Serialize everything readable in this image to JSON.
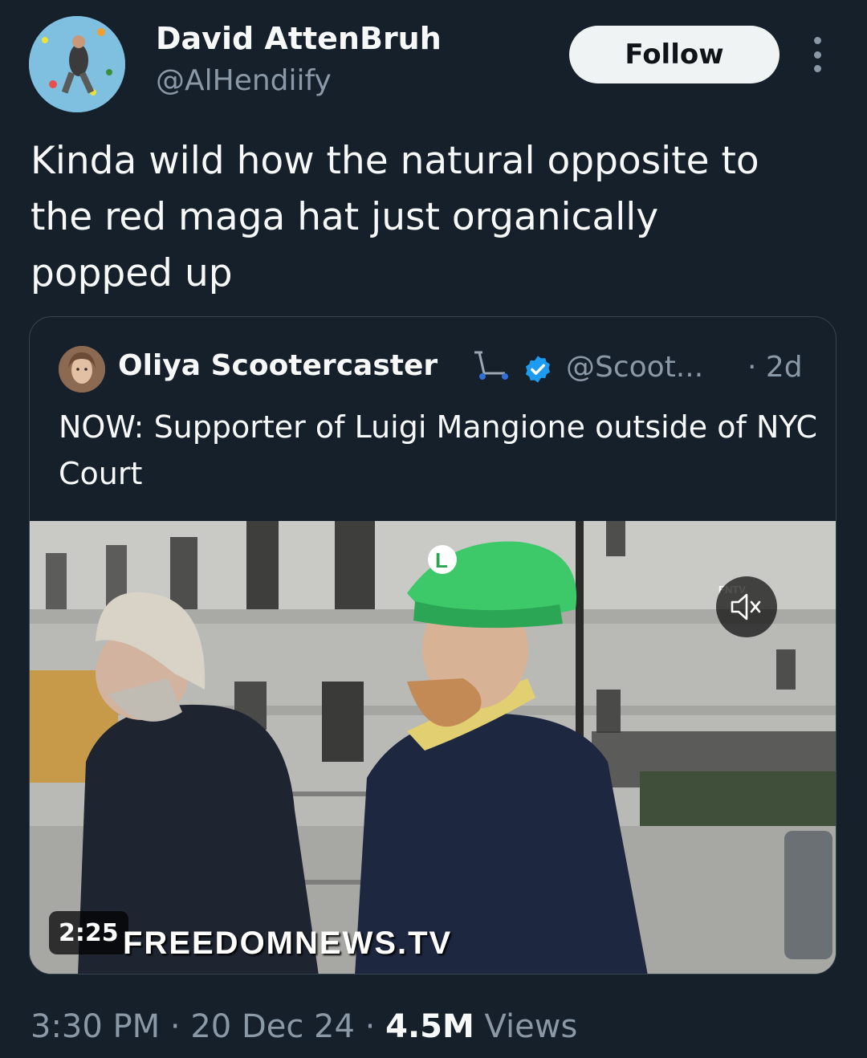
{
  "author": {
    "display_name": "David AttenBruh",
    "handle": "@AlHendiify"
  },
  "follow_label": "Follow",
  "tweet_text": "Kinda wild how the natural opposite to the red maga hat just organically popped up",
  "quoted": {
    "display_name": "Oliya Scootercaster",
    "handle": "@Scoot...",
    "time": "· 2d",
    "text": "NOW: Supporter of Luigi Mangione outside of NYC Court",
    "media": {
      "duration": "2:25",
      "watermark": "FREEDOMNEWS.TV",
      "channel_bug": "FNTV",
      "muted": true
    }
  },
  "footer": {
    "time": "3:30 PM",
    "date": "20 Dec 24",
    "views_count": "4.5M",
    "views_label": "Views",
    "separator": " · "
  },
  "colors": {
    "background": "#15202b",
    "text_primary": "#f7f9f9",
    "text_secondary": "#8b98a5",
    "border": "#38444d",
    "verified": "#1d9bf0",
    "follow_bg": "#eff3f4"
  },
  "icons": [
    "more-options-icon",
    "scooter-emoji-icon",
    "verified-badge-icon",
    "volume-muted-icon"
  ]
}
